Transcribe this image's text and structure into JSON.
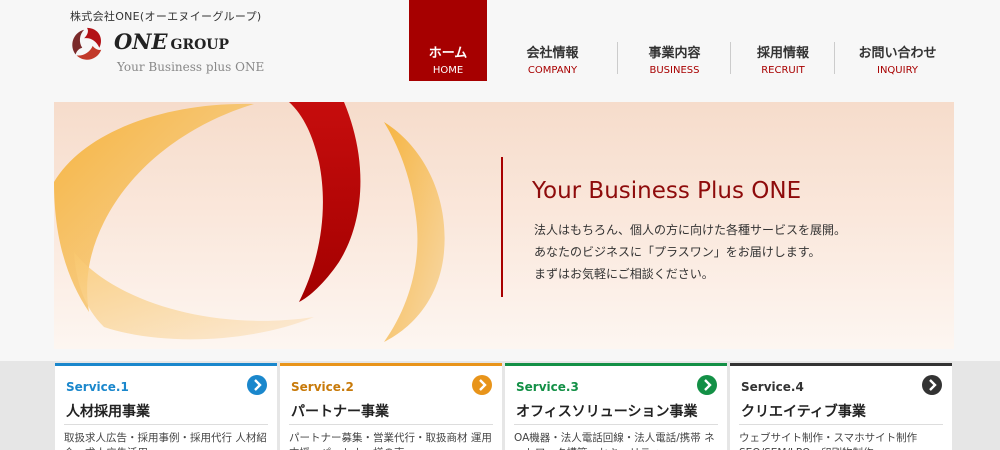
{
  "header": {
    "company_name": "株式会社ONE(オーエヌイーグループ)",
    "logo_one": "ONE",
    "logo_group": "GROUP",
    "tagline": "Your Business plus ONE"
  },
  "nav": {
    "items": [
      {
        "jp": "ホーム",
        "en": "HOME",
        "active": true
      },
      {
        "jp": "会社情報",
        "en": "COMPANY"
      },
      {
        "jp": "事業内容",
        "en": "BUSINESS"
      },
      {
        "jp": "採用情報",
        "en": "RECRUIT"
      },
      {
        "jp": "お問い合わせ",
        "en": "INQUIRY"
      }
    ]
  },
  "hero": {
    "title": "Your Business Plus ONE",
    "lines": [
      "法人はもちろん、個人の方に向けた各種サービスを展開。",
      "あなたのビジネスに「プラスワン」をお届けします。",
      "まずはお気軽にご相談ください。"
    ]
  },
  "services": [
    {
      "num": "Service.1",
      "title": "人材採用事業",
      "desc": "取扱求人広告・採用事例・採用代行 人材紹介・求人広告活用",
      "color": "#1a87cc"
    },
    {
      "num": "Service.2",
      "title": "パートナー事業",
      "desc": "パートナー募集・営業代行・取扱商材 運用支援・パートナー様の声",
      "color": "#e8941a"
    },
    {
      "num": "Service.3",
      "title": "オフィスソリューション事業",
      "desc": "OA機器・法人電話回線・法人電話/携帯 ネットワーク構築・セキュリティ",
      "color": "#139046"
    },
    {
      "num": "Service.4",
      "title": "クリエイティブ事業",
      "desc": "ウェブサイト制作・スマホサイト制作 SEO/SEM/LPO・印刷物制作",
      "color": "#333333"
    }
  ]
}
